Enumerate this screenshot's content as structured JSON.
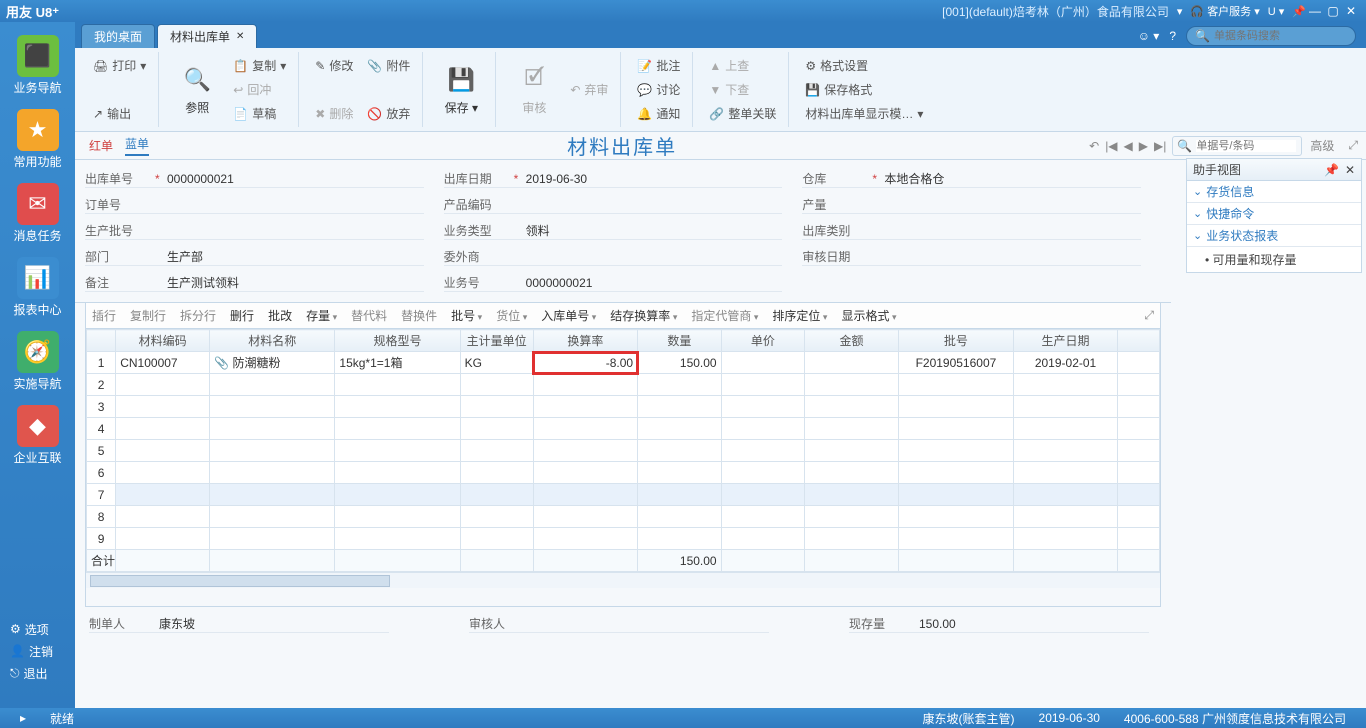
{
  "app": {
    "name": "用友 U8⁺",
    "company": "[001](default)焙考林（广州）食品有限公司",
    "service": "客户服务"
  },
  "leftnav": {
    "items": [
      {
        "label": "业务导航",
        "color": "#6cbf3f"
      },
      {
        "label": "常用功能",
        "color": "#f4a52a"
      },
      {
        "label": "消息任务",
        "color": "#e04d4d"
      },
      {
        "label": "报表中心",
        "color": "#3b8dd0"
      },
      {
        "label": "实施导航",
        "color": "#3fae6c"
      },
      {
        "label": "企业互联",
        "color": "#e0554d"
      }
    ],
    "options": "选项",
    "logout": "注销",
    "exit": "退出"
  },
  "tabs": {
    "t1": "我的桌面",
    "t2": "材料出库单"
  },
  "search_placeholder": "单据条码搜索",
  "ribbon": {
    "print": "打印",
    "output": "输出",
    "ref": "参照",
    "copy": "复制",
    "rewind": "回冲",
    "draft": "草稿",
    "modify": "修改",
    "attach": "附件",
    "delete": "删除",
    "abandon": "放弃",
    "save": "保存",
    "audit": "审核",
    "discard": "弃审",
    "note": "批注",
    "discuss": "讨论",
    "notify": "通知",
    "up": "上查",
    "down": "下查",
    "linkclose": "整单关联",
    "format": "格式设置",
    "saveformat": "保存格式",
    "displaytpl": "材料出库单显示模…"
  },
  "doc": {
    "red": "红单",
    "blue": "蓝单",
    "title": "材料出库单",
    "search_ph": "单据号/条码",
    "advanced": "高级"
  },
  "form": {
    "out_no_l": "出库单号",
    "out_no": "0000000021",
    "out_date_l": "出库日期",
    "out_date": "2019-06-30",
    "wh_l": "仓库",
    "wh": "本地合格仓",
    "order_l": "订单号",
    "pcode_l": "产品编码",
    "qty_l": "产量",
    "batch_l": "生产批号",
    "btype_l": "业务类型",
    "btype": "领料",
    "outtype_l": "出库类别",
    "dept_l": "部门",
    "dept": "生产部",
    "out_l": "委外商",
    "audit_date_l": "审核日期",
    "remark_l": "备注",
    "remark": "生产测试领料",
    "bno_l": "业务号",
    "bno": "0000000021"
  },
  "gridbar": {
    "insrow": "插行",
    "copyrow": "复制行",
    "splitrow": "拆分行",
    "delrow": "删行",
    "batchmod": "批改",
    "stock": "存量",
    "altmat": "替代料",
    "altpart": "替换件",
    "lot": "批号",
    "loc": "货位",
    "inno": "入库单号",
    "convrate": "结存换算率",
    "keeper": "指定代管商",
    "sort": "排序定位",
    "dispfmt": "显示格式"
  },
  "columns": {
    "c0": "",
    "c1": "材料编码",
    "c2": "材料名称",
    "c3": "规格型号",
    "c4": "主计量单位",
    "c5": "换算率",
    "c6": "数量",
    "c7": "单价",
    "c8": "金额",
    "c9": "批号",
    "c10": "生产日期"
  },
  "row": {
    "code": "CN100007",
    "name": "防潮糖粉",
    "spec": "15kg*1=1箱",
    "uom": "KG",
    "rate": "-8.00",
    "qty": "150.00",
    "lot": "F20190516007",
    "pdate": "2019-02-01"
  },
  "total_l": "合计",
  "total_qty": "150.00",
  "foot": {
    "maker_l": "制单人",
    "maker": "康东坡",
    "auditor_l": "审核人",
    "stock_l": "现存量",
    "stock": "150.00"
  },
  "right": {
    "hdr": "助手视图",
    "s1": "存货信息",
    "s2": "快捷命令",
    "s3": "业务状态报表",
    "i1": "可用量和现存量"
  },
  "status": {
    "ready": "就绪",
    "user": "康东坡(账套主管)",
    "date": "2019-06-30",
    "tel": "4006-600-588 广州领度信息技术有限公司"
  }
}
